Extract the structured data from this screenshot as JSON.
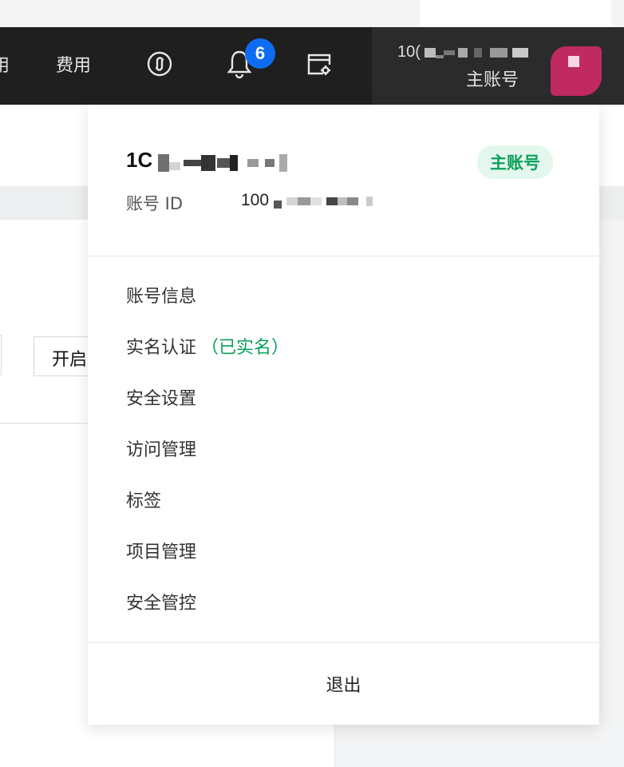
{
  "navbar": {
    "cut_label": "用",
    "fee_label": "费用",
    "notification_count": "6",
    "account_id_prefix": "10(",
    "account_role": "主账号"
  },
  "background": {
    "toggle_label": "开启"
  },
  "dropdown": {
    "account_name_prefix": "1C",
    "role_badge": "主账号",
    "account_id_label": "账号 ID",
    "account_id_prefix": "100",
    "menu": [
      {
        "label": "账号信息"
      },
      {
        "label": "实名认证",
        "status": "（已实名）"
      },
      {
        "label": "安全设置"
      },
      {
        "label": "访问管理"
      },
      {
        "label": "标签"
      },
      {
        "label": "项目管理"
      },
      {
        "label": "安全管控"
      }
    ],
    "logout_label": "退出"
  },
  "colors": {
    "navbar_bg": "#1f1f1f",
    "badge_blue": "#0e6cf2",
    "verified_green": "#0aa05a",
    "avatar": "#c02a61"
  },
  "icons": [
    "link-circle-icon",
    "bell-icon",
    "console-settings-icon"
  ]
}
